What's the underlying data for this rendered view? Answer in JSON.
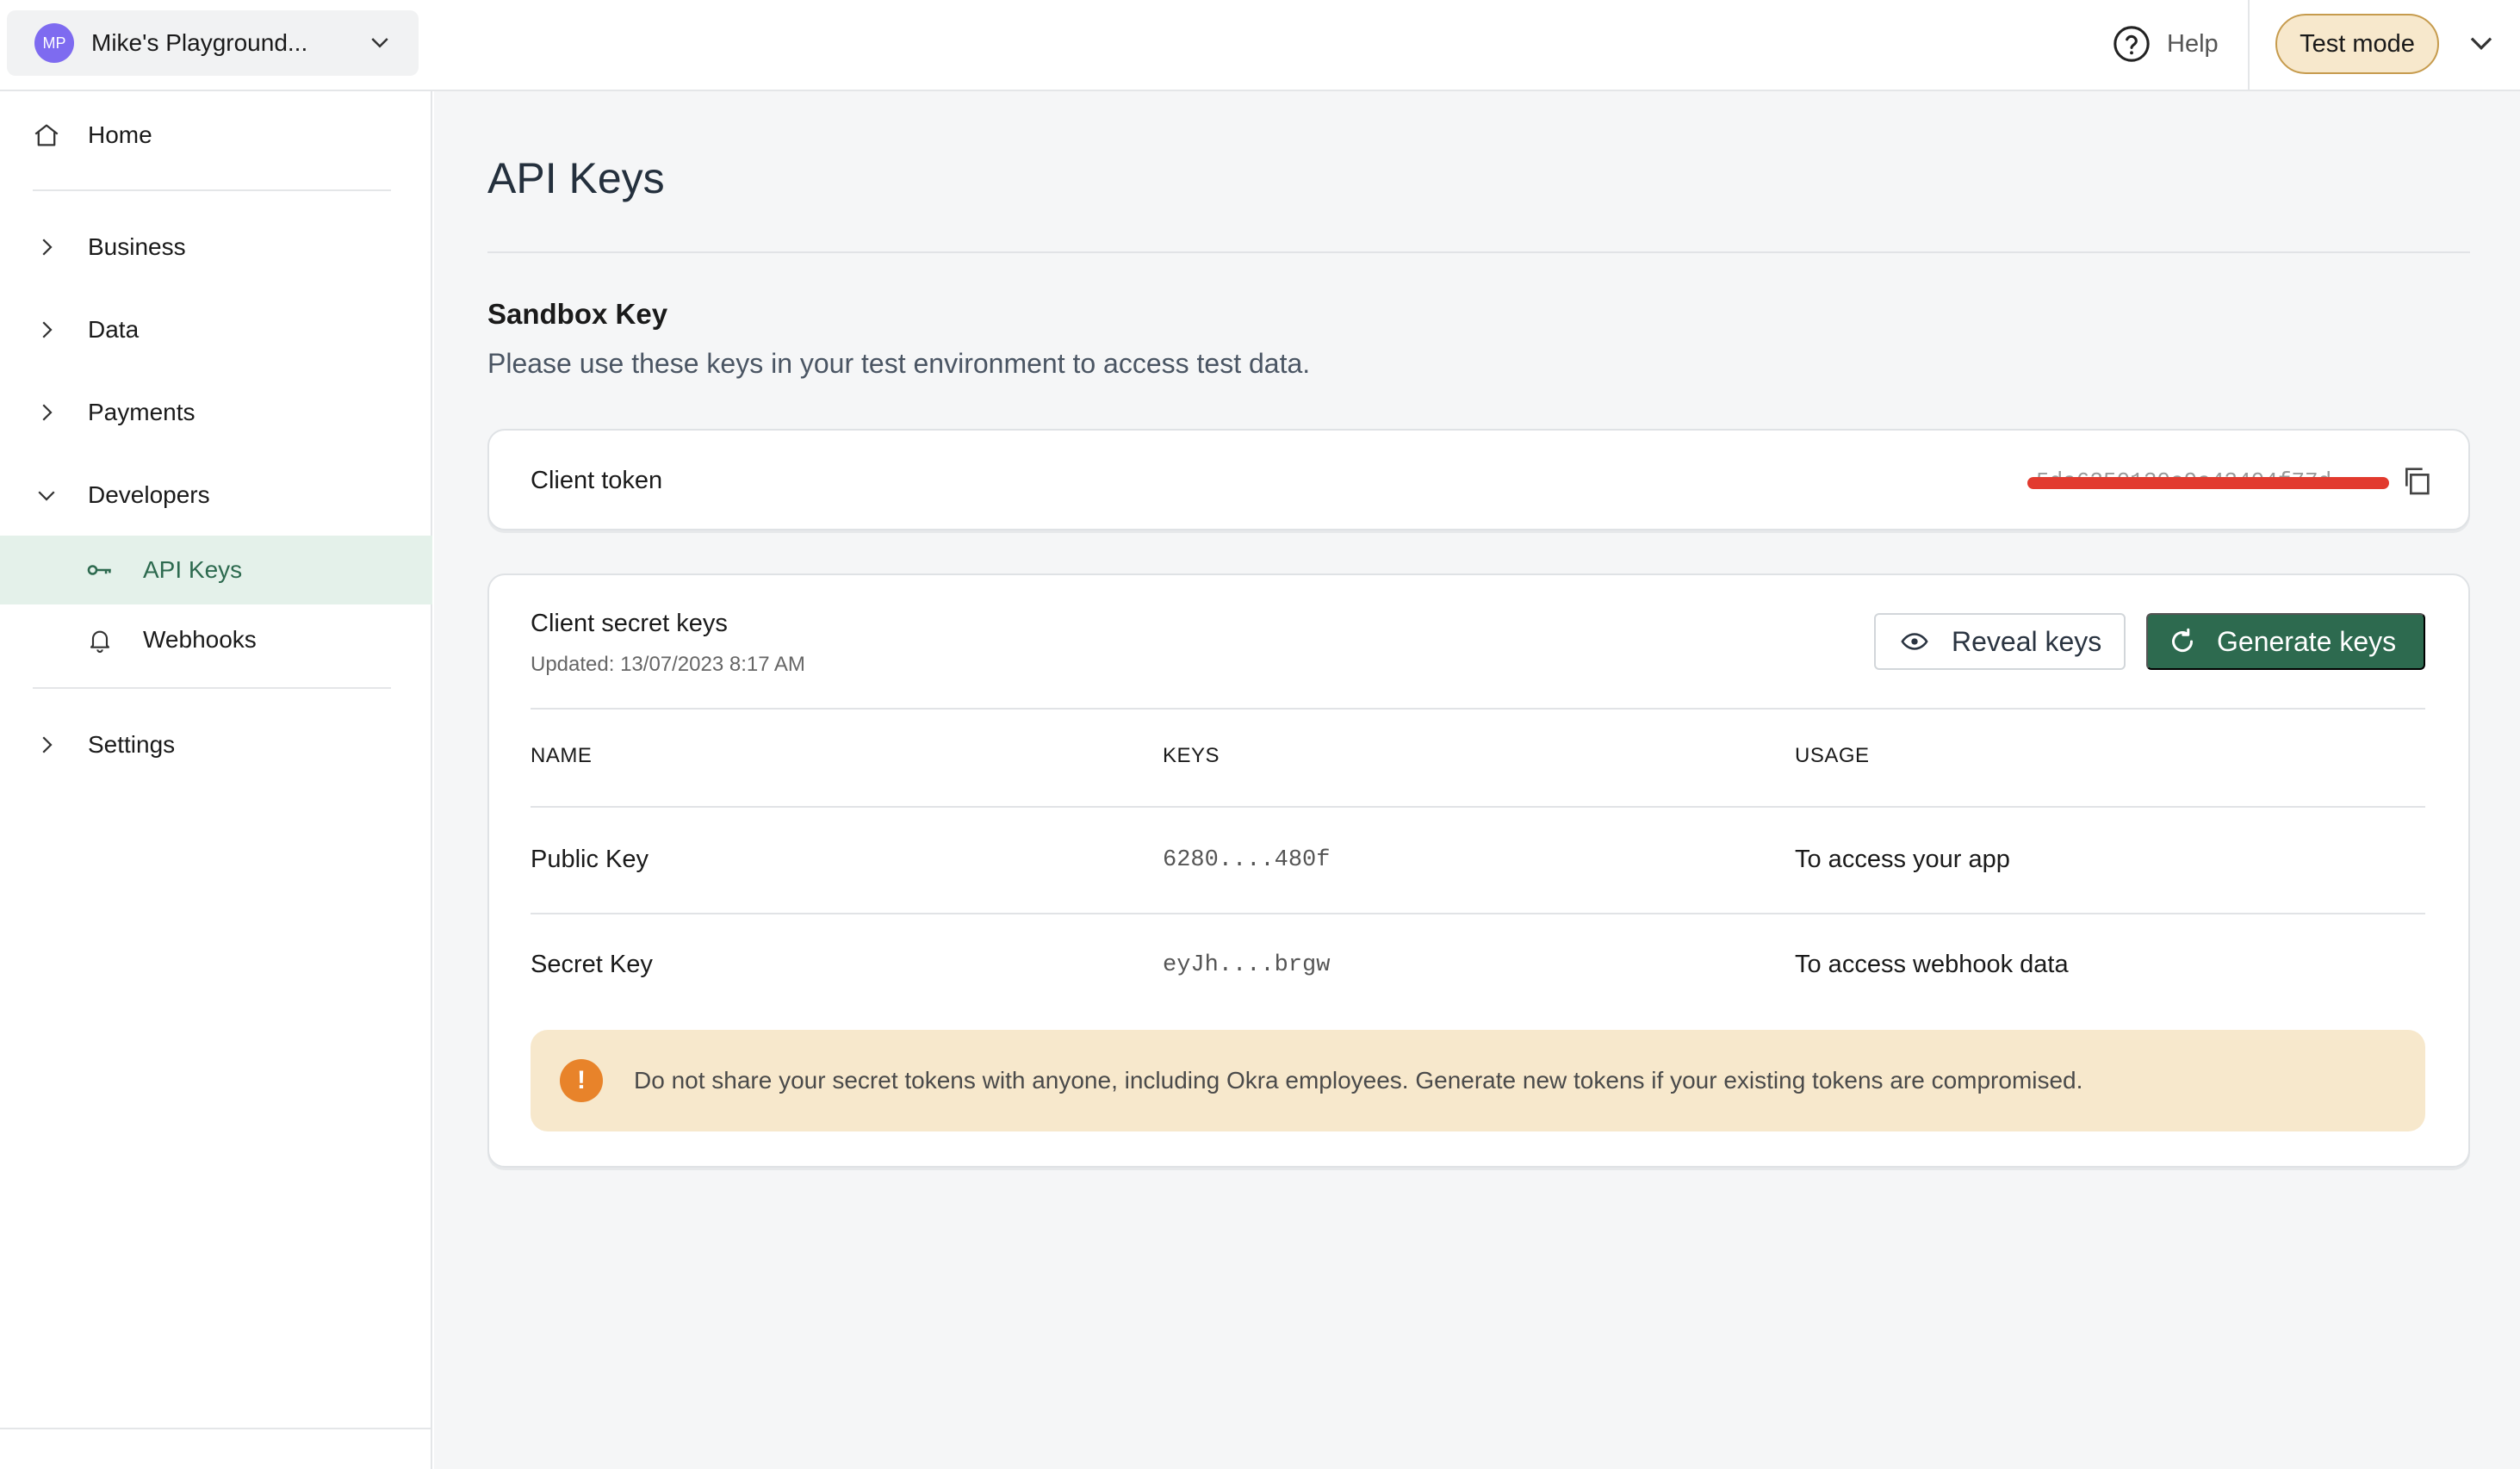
{
  "workspace": {
    "initials": "MP",
    "name": "Mike's Playground..."
  },
  "topbar": {
    "help_label": "Help",
    "mode_label": "Test mode"
  },
  "sidebar": {
    "items": [
      {
        "label": "Home"
      },
      {
        "label": "Business"
      },
      {
        "label": "Data"
      },
      {
        "label": "Payments"
      },
      {
        "label": "Developers"
      },
      {
        "label": "API Keys"
      },
      {
        "label": "Webhooks"
      },
      {
        "label": "Settings"
      }
    ]
  },
  "main": {
    "title": "API Keys",
    "section_title": "Sandbox Key",
    "section_desc": "Please use these keys in your test environment to access test data.",
    "client_token": {
      "label": "Client token",
      "value": "5da6350130c9e43404f77d"
    },
    "secret_keys": {
      "title": "Client secret keys",
      "updated": "Updated: 13/07/2023 8:17 AM",
      "reveal_label": "Reveal keys",
      "generate_label": "Generate keys",
      "columns": [
        "NAME",
        "KEYS",
        "USAGE"
      ],
      "rows": [
        {
          "name": "Public Key",
          "key": "6280....480f",
          "usage": "To access your app"
        },
        {
          "name": "Secret Key",
          "key": "eyJh....brgw",
          "usage": "To access webhook data"
        }
      ]
    },
    "warning": "Do not share your secret tokens with anyone, including Okra employees. Generate new tokens if your existing tokens are compromised."
  },
  "colors": {
    "accent": "#2d6a4f",
    "warning_bg": "#f7e8cc",
    "warning_icon": "#e8832a",
    "redaction": "#e23a2e"
  }
}
